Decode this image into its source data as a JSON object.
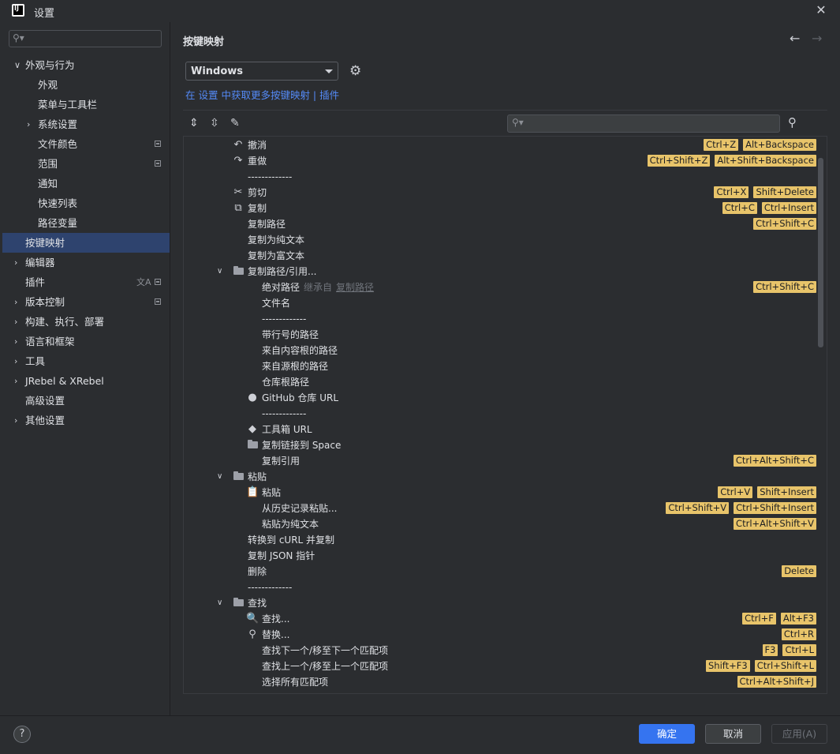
{
  "window": {
    "title": "设置",
    "app_icon_text": "IJ"
  },
  "sidebar": {
    "items": [
      {
        "label": "外观与行为",
        "indent": 1,
        "chevron": "v",
        "pin": false
      },
      {
        "label": "外观",
        "indent": 2,
        "chevron": "",
        "pin": false
      },
      {
        "label": "菜单与工具栏",
        "indent": 2,
        "chevron": "",
        "pin": false
      },
      {
        "label": "系统设置",
        "indent": 2,
        "chevron": ">",
        "pin": false
      },
      {
        "label": "文件颜色",
        "indent": 2,
        "chevron": "",
        "pin": true
      },
      {
        "label": "范围",
        "indent": 2,
        "chevron": "",
        "pin": true
      },
      {
        "label": "通知",
        "indent": 2,
        "chevron": "",
        "pin": false
      },
      {
        "label": "快速列表",
        "indent": 2,
        "chevron": "",
        "pin": false
      },
      {
        "label": "路径变量",
        "indent": 2,
        "chevron": "",
        "pin": false
      },
      {
        "label": "按键映射",
        "indent": 1,
        "chevron": "",
        "pin": false,
        "selected": true
      },
      {
        "label": "编辑器",
        "indent": 1,
        "chevron": ">",
        "pin": false
      },
      {
        "label": "插件",
        "indent": 1,
        "chevron": "",
        "pin": true,
        "translate": true
      },
      {
        "label": "版本控制",
        "indent": 1,
        "chevron": ">",
        "pin": true
      },
      {
        "label": "构建、执行、部署",
        "indent": 1,
        "chevron": ">",
        "pin": false
      },
      {
        "label": "语言和框架",
        "indent": 1,
        "chevron": ">",
        "pin": false
      },
      {
        "label": "工具",
        "indent": 1,
        "chevron": ">",
        "pin": false
      },
      {
        "label": "JRebel & XRebel",
        "indent": 1,
        "chevron": ">",
        "pin": false
      },
      {
        "label": "高级设置",
        "indent": 1,
        "chevron": "",
        "pin": false
      },
      {
        "label": "其他设置",
        "indent": 1,
        "chevron": ">",
        "pin": false
      }
    ]
  },
  "main": {
    "title": "按键映射",
    "keymap_value": "Windows",
    "link_text": "在 设置 中获取更多按键映射 | 插件",
    "tree": [
      {
        "label": "撤消",
        "level": 2,
        "icon": "↶",
        "shortcuts": [
          "Ctrl+Z",
          "Alt+Backspace"
        ]
      },
      {
        "label": "重做",
        "level": 2,
        "icon": "↷",
        "shortcuts": [
          "Ctrl+Shift+Z",
          "Alt+Shift+Backspace"
        ]
      },
      {
        "label": "-------------",
        "level": 2,
        "icon": "",
        "shortcuts": []
      },
      {
        "label": "剪切",
        "level": 2,
        "icon": "✂",
        "shortcuts": [
          "Ctrl+X",
          "Shift+Delete"
        ]
      },
      {
        "label": "复制",
        "level": 2,
        "icon": "⧉",
        "shortcuts": [
          "Ctrl+C",
          "Ctrl+Insert"
        ]
      },
      {
        "label": "复制路径",
        "level": 2,
        "icon": "",
        "shortcuts": [
          "Ctrl+Shift+C"
        ]
      },
      {
        "label": "复制为纯文本",
        "level": 2,
        "icon": "",
        "shortcuts": []
      },
      {
        "label": "复制为富文本",
        "level": 2,
        "icon": "",
        "shortcuts": []
      },
      {
        "label": "复制路径/引用...",
        "level": 2,
        "icon": "folder",
        "expand": "v",
        "shortcuts": []
      },
      {
        "label": "绝对路径",
        "level": 3,
        "icon": "",
        "suffix_dim": "继承自",
        "suffix_link": "复制路径",
        "shortcuts": [
          "Ctrl+Shift+C"
        ]
      },
      {
        "label": "文件名",
        "level": 3,
        "icon": "",
        "shortcuts": []
      },
      {
        "label": "-------------",
        "level": 3,
        "icon": "",
        "shortcuts": []
      },
      {
        "label": "带行号的路径",
        "level": 3,
        "icon": "",
        "shortcuts": []
      },
      {
        "label": "来自内容根的路径",
        "level": 3,
        "icon": "",
        "shortcuts": []
      },
      {
        "label": "来自源根的路径",
        "level": 3,
        "icon": "",
        "shortcuts": []
      },
      {
        "label": "仓库根路径",
        "level": 3,
        "icon": "",
        "shortcuts": []
      },
      {
        "label": "GitHub 仓库 URL",
        "level": 3,
        "icon": "●",
        "shortcuts": []
      },
      {
        "label": "-------------",
        "level": 3,
        "icon": "",
        "shortcuts": []
      },
      {
        "label": "工具箱 URL",
        "level": 3,
        "icon": "◆",
        "shortcuts": []
      },
      {
        "label": "复制链接到 Space",
        "level": 3,
        "icon": "folder",
        "shortcuts": []
      },
      {
        "label": "复制引用",
        "level": 3,
        "icon": "",
        "shortcuts": [
          "Ctrl+Alt+Shift+C"
        ]
      },
      {
        "label": "粘贴",
        "level": 2,
        "icon": "folder",
        "expand": "v",
        "shortcuts": []
      },
      {
        "label": "粘贴",
        "level": 3,
        "icon": "📋",
        "shortcuts": [
          "Ctrl+V",
          "Shift+Insert"
        ]
      },
      {
        "label": "从历史记录粘贴...",
        "level": 3,
        "icon": "",
        "shortcuts": [
          "Ctrl+Shift+V",
          "Ctrl+Shift+Insert"
        ]
      },
      {
        "label": "粘贴为纯文本",
        "level": 3,
        "icon": "",
        "shortcuts": [
          "Ctrl+Alt+Shift+V"
        ]
      },
      {
        "label": "转换到 cURL 并复制",
        "level": 2,
        "icon": "",
        "shortcuts": []
      },
      {
        "label": "复制 JSON 指针",
        "level": 2,
        "icon": "",
        "shortcuts": []
      },
      {
        "label": "删除",
        "level": 2,
        "icon": "",
        "shortcuts": [
          "Delete"
        ]
      },
      {
        "label": "-------------",
        "level": 2,
        "icon": "",
        "shortcuts": []
      },
      {
        "label": "查找",
        "level": 2,
        "icon": "folder",
        "expand": "v",
        "shortcuts": []
      },
      {
        "label": "查找...",
        "level": 3,
        "icon": "🔍",
        "shortcuts": [
          "Ctrl+F",
          "Alt+F3"
        ]
      },
      {
        "label": "替换...",
        "level": 3,
        "icon": "⚲",
        "shortcuts": [
          "Ctrl+R"
        ]
      },
      {
        "label": "查找下一个/移至下一个匹配项",
        "level": 3,
        "icon": "",
        "shortcuts": [
          "F3",
          "Ctrl+L"
        ]
      },
      {
        "label": "查找上一个/移至上一个匹配项",
        "level": 3,
        "icon": "",
        "shortcuts": [
          "Shift+F3",
          "Ctrl+Shift+L"
        ]
      },
      {
        "label": "选择所有匹配项",
        "level": 3,
        "icon": "",
        "shortcuts": [
          "Ctrl+Alt+Shift+J"
        ]
      }
    ]
  },
  "buttons": {
    "ok": "确定",
    "cancel": "取消",
    "apply": "应用(A)",
    "help": "?"
  },
  "colors": {
    "accent": "#3574f0",
    "selection": "#2e436e",
    "shortcut_bg": "#e8c46a",
    "link": "#548af7"
  }
}
